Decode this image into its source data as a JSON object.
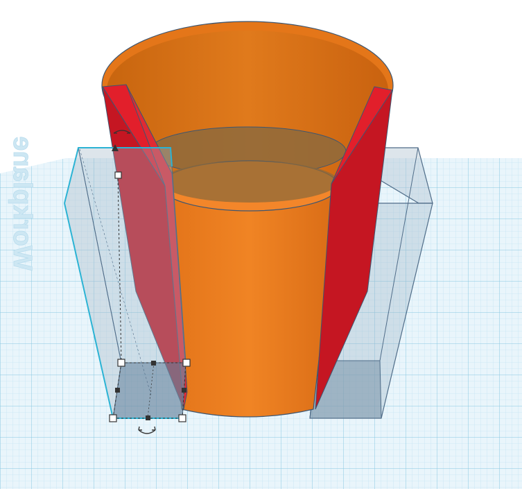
{
  "workplane": {
    "label": "Workplane"
  },
  "colors": {
    "grid_bg": "#e8f4fa",
    "grid_fine": "#b5dcea",
    "grid_major": "#7fc3dd",
    "cup": "#e8781f",
    "cup_inner": "#d9711c",
    "wedge": "#e0242e",
    "hole_box": "#a9bfcf",
    "selection": "#2bb3d4"
  },
  "shapes": [
    {
      "name": "cup",
      "type": "solid"
    },
    {
      "name": "wedge-left",
      "type": "solid"
    },
    {
      "name": "wedge-right",
      "type": "solid"
    },
    {
      "name": "hole-box-left",
      "type": "hole",
      "selected": true
    },
    {
      "name": "hole-box-right",
      "type": "hole",
      "selected": false
    }
  ]
}
